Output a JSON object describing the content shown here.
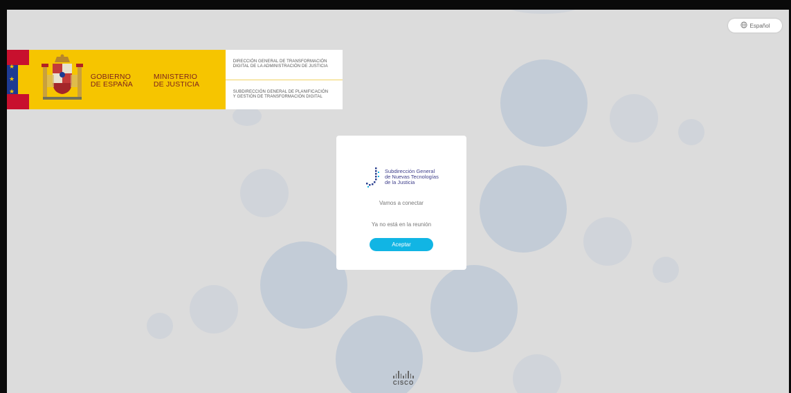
{
  "language": {
    "label": "Español",
    "icon": "globe-icon"
  },
  "header": {
    "gov_line1": "GOBIERNO",
    "gov_line2": "DE ESPAÑA",
    "ministry_line1": "MINISTERIO",
    "ministry_line2": "DE JUSTICIA",
    "directorate_line1": "DIRECCIÓN GENERAL DE TRANSFORMACIÓN",
    "directorate_line2": "DIGITAL DE LA ADMINISTRACIÓN DE JUSTICIA",
    "subdirectorate_line1": "SUBDIRECCIÓN GENERAL DE PLANIFICACIÓN",
    "subdirectorate_line2": "Y GESTIÓN DE TRANSFORMACIÓN DIGITAL"
  },
  "dialog": {
    "logo_line1": "Subdirección General",
    "logo_line2": "de Nuevas Tecnologías",
    "logo_line3": "de la Justicia",
    "message_connecting": "Vamos a conectar",
    "message_status": "Ya no está en la reunión",
    "accept_label": "Aceptar"
  },
  "footer": {
    "brand": "CISCO",
    "icon": "cisco-logo-icon"
  },
  "colors": {
    "accent": "#11b5e4",
    "background": "#dcdcdc",
    "flag_yellow": "#f6c500",
    "flag_red": "#c8102e"
  }
}
